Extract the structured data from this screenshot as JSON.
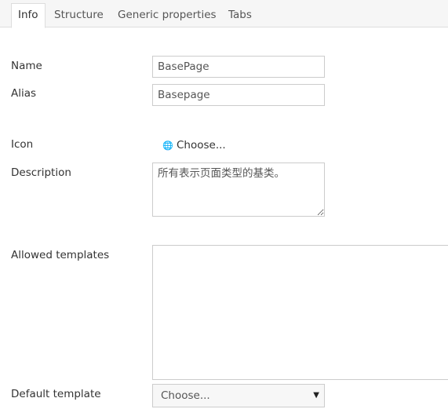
{
  "tabs": [
    {
      "label": "Info",
      "active": true
    },
    {
      "label": "Structure"
    },
    {
      "label": "Generic properties"
    },
    {
      "label": "Tabs"
    }
  ],
  "form": {
    "name": {
      "label": "Name",
      "value": "BasePage"
    },
    "alias": {
      "label": "Alias",
      "value": "Basepage"
    },
    "icon": {
      "label": "Icon",
      "icon": "globe-icon",
      "glyph": "🌐",
      "choose": "Choose..."
    },
    "description": {
      "label": "Description",
      "value": "所有表示页面类型的基类。"
    },
    "allowed_templates": {
      "label": "Allowed templates"
    },
    "default_template": {
      "label": "Default template",
      "selected": "Choose..."
    }
  }
}
